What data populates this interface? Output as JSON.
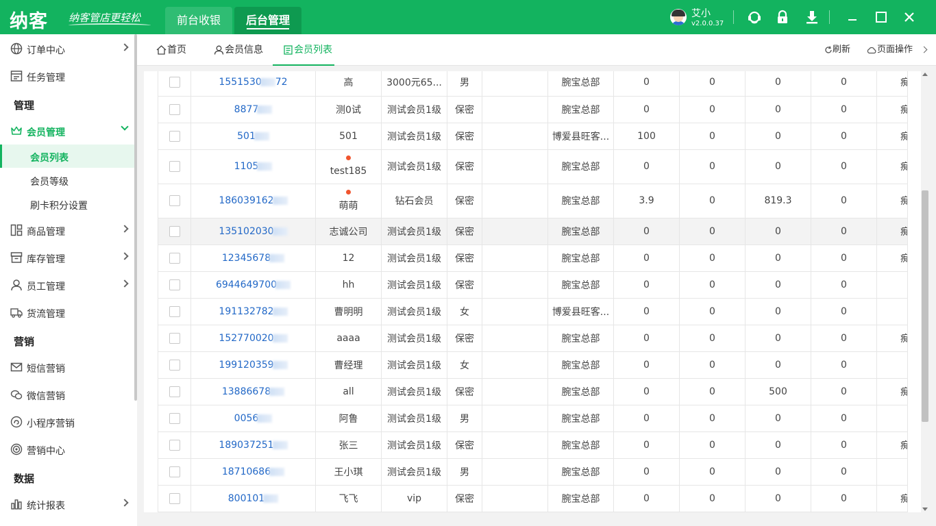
{
  "header": {
    "logo": "纳客",
    "slogan": "纳客管店更轻松",
    "tabs": [
      {
        "label": "前台收银"
      },
      {
        "label": "后台管理"
      }
    ],
    "user": {
      "name": "艾小",
      "version": "v2.0.0.37"
    },
    "icons": [
      "headset-icon",
      "lock-icon",
      "download-icon",
      "minimize-icon",
      "maximize-icon",
      "close-icon"
    ],
    "accent_color": "#13b35f"
  },
  "sidebar": {
    "items": [
      {
        "label": "订单中心",
        "icon": "globe-icon"
      },
      {
        "label": "任务管理",
        "icon": "task-icon"
      },
      {
        "label": "管理"
      },
      {
        "label": "会员管理",
        "icon": "crown-icon"
      },
      {
        "label": "会员列表"
      },
      {
        "label": "会员等级"
      },
      {
        "label": "刷卡积分设置"
      },
      {
        "label": "商品管理",
        "icon": "goods-icon"
      },
      {
        "label": "库存管理",
        "icon": "inventory-icon"
      },
      {
        "label": "员工管理",
        "icon": "staff-icon"
      },
      {
        "label": "货流管理",
        "icon": "truck-icon"
      },
      {
        "label": "营销"
      },
      {
        "label": "短信营销",
        "icon": "mail-icon"
      },
      {
        "label": "微信营销",
        "icon": "wechat-icon"
      },
      {
        "label": "小程序营销",
        "icon": "miniprogram-icon"
      },
      {
        "label": "营销中心",
        "icon": "target-icon"
      },
      {
        "label": "数据"
      },
      {
        "label": "统计报表",
        "icon": "chart-icon"
      }
    ]
  },
  "page_tabs": [
    {
      "label": "首页",
      "icon": "home-icon"
    },
    {
      "label": "会员信息",
      "icon": "user-icon"
    },
    {
      "label": "会员列表",
      "icon": "list-icon"
    }
  ],
  "actions": {
    "refresh": "刷新",
    "page_ops": "页面操作"
  },
  "table": {
    "rows": [
      {
        "phone": "1551530",
        "phone_tail": "72",
        "name": "高",
        "level": "3000元65...",
        "gender": "男",
        "store": "腕宝总部",
        "v1": "0",
        "v2": "0",
        "v3": "0",
        "v4": "0",
        "extra": "痴"
      },
      {
        "phone": "8877",
        "name": "测0试",
        "level": "测试会员1级",
        "gender": "保密",
        "store": "腕宝总部",
        "v1": "0",
        "v2": "0",
        "v3": "0",
        "v4": "0",
        "extra": "痴"
      },
      {
        "phone": "501",
        "name": "501",
        "level": "测试会员1级",
        "gender": "保密",
        "store": "博爱县旺客...",
        "v1": "100",
        "v2": "0",
        "v3": "0",
        "v4": "0",
        "extra": "痴"
      },
      {
        "phone": "1105",
        "name": "test185",
        "level": "测试会员1级",
        "gender": "保密",
        "store": "腕宝总部",
        "v1": "0",
        "v2": "0",
        "v3": "0",
        "v4": "0",
        "extra": "痴"
      },
      {
        "phone": "186039162",
        "name": "萌萌",
        "level": "钻石会员",
        "gender": "保密",
        "store": "腕宝总部",
        "v1": "3.9",
        "v2": "0",
        "v3": "819.3",
        "v4": "0",
        "extra": "痴"
      },
      {
        "phone": "135102030",
        "name": "志诚公司",
        "level": "测试会员1级",
        "gender": "保密",
        "store": "腕宝总部",
        "v1": "0",
        "v2": "0",
        "v3": "0",
        "v4": "0",
        "extra": "痴"
      },
      {
        "phone": "12345678",
        "name": "12",
        "level": "测试会员1级",
        "gender": "保密",
        "store": "腕宝总部",
        "v1": "0",
        "v2": "0",
        "v3": "0",
        "v4": "0",
        "extra": "痴"
      },
      {
        "phone": "6944649700",
        "name": "hh",
        "level": "测试会员1级",
        "gender": "保密",
        "store": "腕宝总部",
        "v1": "0",
        "v2": "0",
        "v3": "0",
        "v4": "0",
        "extra": ""
      },
      {
        "phone": "191132782",
        "name": "曹明明",
        "level": "测试会员1级",
        "gender": "女",
        "store": "博爱县旺客...",
        "v1": "0",
        "v2": "0",
        "v3": "0",
        "v4": "0",
        "extra": ""
      },
      {
        "phone": "152770020",
        "name": "aaaa",
        "level": "测试会员1级",
        "gender": "保密",
        "store": "腕宝总部",
        "v1": "0",
        "v2": "0",
        "v3": "0",
        "v4": "0",
        "extra": "痴"
      },
      {
        "phone": "199120359",
        "name": "曹经理",
        "level": "测试会员1级",
        "gender": "女",
        "store": "腕宝总部",
        "v1": "0",
        "v2": "0",
        "v3": "0",
        "v4": "0",
        "extra": ""
      },
      {
        "phone": "13886678",
        "name": "all",
        "level": "测试会员1级",
        "gender": "保密",
        "store": "腕宝总部",
        "v1": "0",
        "v2": "0",
        "v3": "500",
        "v4": "0",
        "extra": "痴"
      },
      {
        "phone": "0056",
        "name": "阿鲁",
        "level": "测试会员1级",
        "gender": "男",
        "store": "腕宝总部",
        "v1": "0",
        "v2": "0",
        "v3": "0",
        "v4": "0",
        "extra": ""
      },
      {
        "phone": "189037251",
        "name": "张三",
        "level": "测试会员1级",
        "gender": "保密",
        "store": "腕宝总部",
        "v1": "0",
        "v2": "0",
        "v3": "0",
        "v4": "0",
        "extra": "痴"
      },
      {
        "phone": "18710686",
        "name": "王小琪",
        "level": "测试会员1级",
        "gender": "男",
        "store": "腕宝总部",
        "v1": "0",
        "v2": "0",
        "v3": "0",
        "v4": "0",
        "extra": ""
      },
      {
        "phone": "800101",
        "name": "飞飞",
        "level": "vip",
        "gender": "保密",
        "store": "腕宝总部",
        "v1": "0",
        "v2": "0",
        "v3": "0",
        "v4": "0",
        "extra": "痴"
      }
    ]
  }
}
